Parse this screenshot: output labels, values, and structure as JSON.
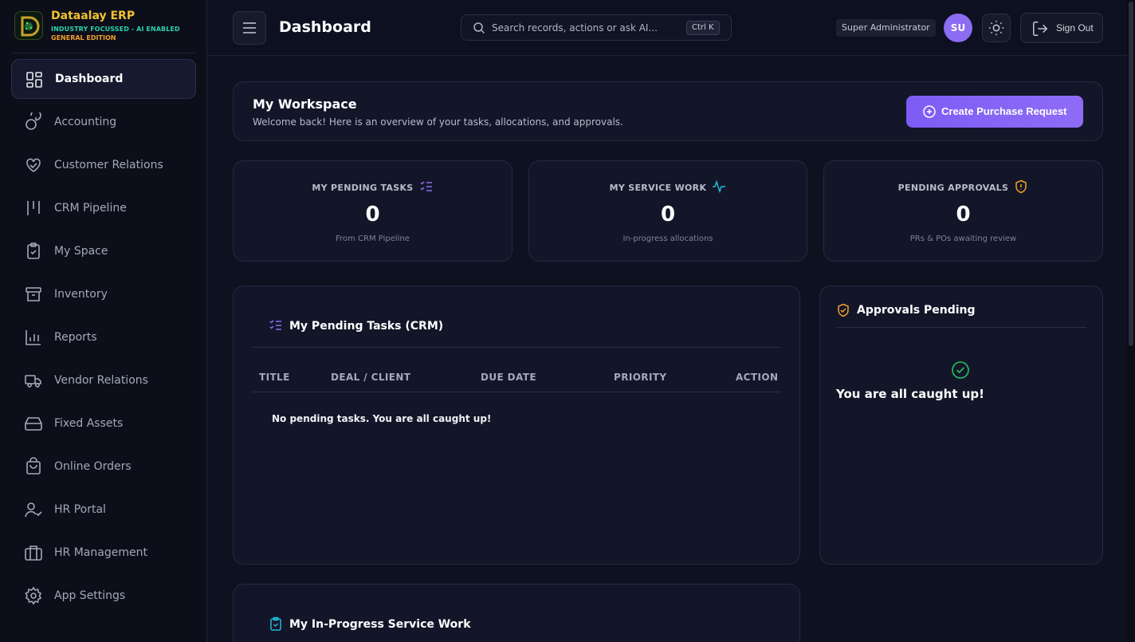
{
  "brand": {
    "name": "Dataalay ERP",
    "tagline": "INDUSTRY FOCUSSED - AI ENABLED",
    "edition": "GENERAL EDITION"
  },
  "sidebar": {
    "items": [
      {
        "label": "Dashboard",
        "icon": "dashboard-icon",
        "active": true
      },
      {
        "label": "Accounting",
        "icon": "coins-icon"
      },
      {
        "label": "Customer Relations",
        "icon": "handshake-heart-icon"
      },
      {
        "label": "CRM Pipeline",
        "icon": "pipeline-icon"
      },
      {
        "label": "My Space",
        "icon": "clipboard-check-icon"
      },
      {
        "label": "Inventory",
        "icon": "archive-icon"
      },
      {
        "label": "Reports",
        "icon": "bar-chart-icon"
      },
      {
        "label": "Vendor Relations",
        "icon": "truck-icon"
      },
      {
        "label": "Fixed Assets",
        "icon": "hard-drive-icon"
      },
      {
        "label": "Online Orders",
        "icon": "shopping-bag-icon"
      },
      {
        "label": "HR Portal",
        "icon": "user-check-icon"
      },
      {
        "label": "HR Management",
        "icon": "briefcase-icon"
      },
      {
        "label": "App Settings",
        "icon": "gear-icon"
      }
    ]
  },
  "header": {
    "title": "Dashboard",
    "search_placeholder": "Search records, actions or ask AI...",
    "search_shortcut": "Ctrl K",
    "role": "Super Administrator",
    "avatar_initials": "SU",
    "signout_label": "Sign Out"
  },
  "workspace": {
    "title": "My Workspace",
    "subtitle": "Welcome back! Here is an overview of your tasks, allocations, and approvals.",
    "cta_label": "Create Purchase Request"
  },
  "stats": [
    {
      "title": "MY PENDING TASKS",
      "value": "0",
      "note": "From CRM Pipeline",
      "icon": "list-check-icon"
    },
    {
      "title": "MY SERVICE WORK",
      "value": "0",
      "note": "In-progress allocations",
      "icon": "activity-icon"
    },
    {
      "title": "PENDING APPROVALS",
      "value": "0",
      "note": "PRs & POs awaiting review",
      "icon": "shield-alert-icon"
    }
  ],
  "tasks_panel": {
    "title": "My Pending Tasks (CRM)",
    "columns": [
      "TITLE",
      "DEAL / CLIENT",
      "DUE DATE",
      "PRIORITY",
      "ACTION"
    ],
    "empty_message": "No pending tasks. You are all caught up!"
  },
  "approvals_panel": {
    "title": "Approvals Pending",
    "message": "You are all caught up!"
  },
  "service_panel": {
    "title": "My In-Progress Service Work"
  },
  "colors": {
    "accent": "#7c5cf4",
    "brand_gold": "#f2c230",
    "brand_teal": "#2fd1a8",
    "warning": "#f2a22a",
    "info": "#22b8d6",
    "success": "#22c55e"
  }
}
